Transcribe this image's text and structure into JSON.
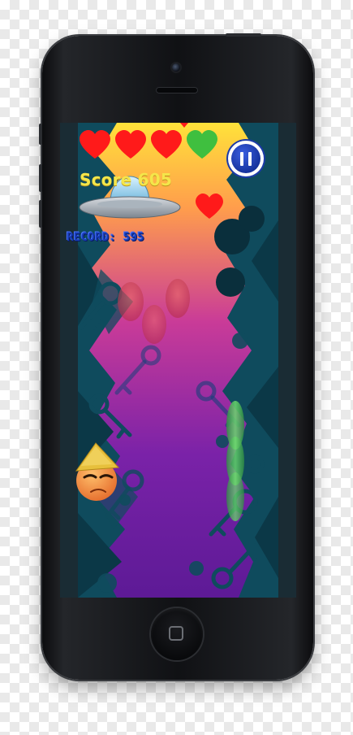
{
  "device": {
    "model_icon": "smartphone-frame",
    "home_icon": "home-button-icon"
  },
  "hud": {
    "lives": [
      {
        "type": "heart",
        "color": "#ff1a1a",
        "state": "full"
      },
      {
        "type": "heart",
        "color": "#ff1a1a",
        "state": "full"
      },
      {
        "type": "heart",
        "color": "#ff1a1a",
        "state": "full"
      },
      {
        "type": "heart",
        "color": "#3fbf3f",
        "state": "bonus"
      }
    ],
    "score_text": "Score 605",
    "record_text": "RECORD: 595",
    "pause_icon": "pause-icon"
  },
  "game": {
    "player_icon": "straw-hat-ball-character-icon",
    "enemy_icon": "ufo-icon",
    "pickup_icon": "heart-pickup-icon",
    "track_gradient": [
      "#ffd83a",
      "#ff9a4a",
      "#c33aa0",
      "#6f1f9e"
    ],
    "wall_color": "#0f4a5c",
    "orb_colors": [
      "#d9474c",
      "#3fae55"
    ]
  }
}
